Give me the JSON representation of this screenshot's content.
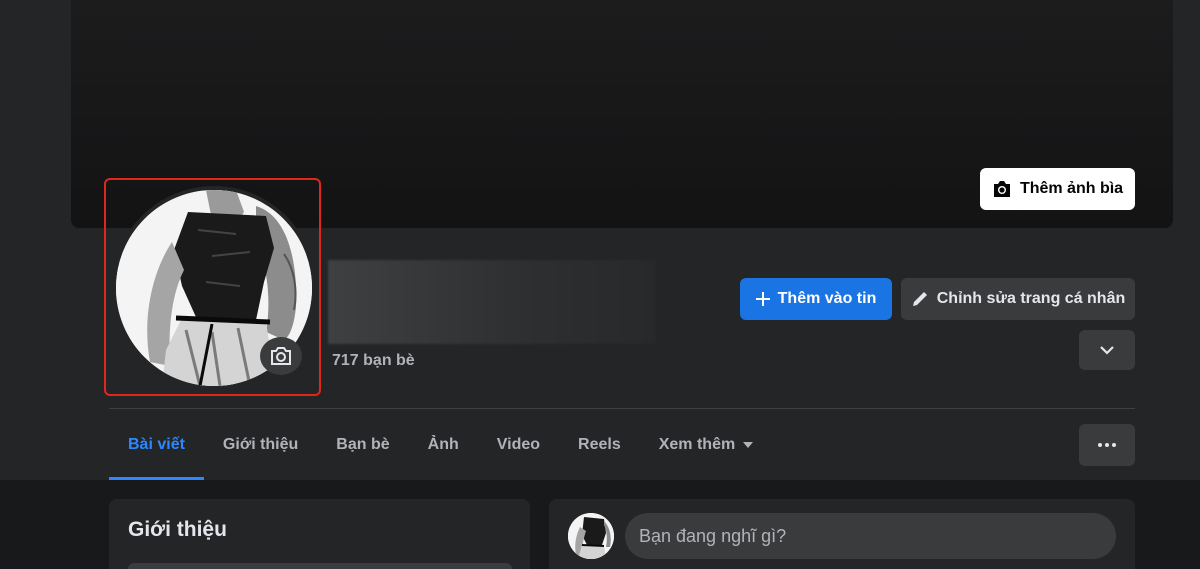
{
  "cover": {
    "add_cover_label": "Thêm ảnh bìa"
  },
  "profile": {
    "friends_count": "717 bạn bè"
  },
  "actions": {
    "add_story_label": "Thêm vào tin",
    "edit_profile_label": "Chỉnh sửa trang cá nhân"
  },
  "tabs": [
    {
      "label": "Bài viết"
    },
    {
      "label": "Giới thiệu"
    },
    {
      "label": "Bạn bè"
    },
    {
      "label": "Ảnh"
    },
    {
      "label": "Video"
    },
    {
      "label": "Reels"
    },
    {
      "label": "Xem thêm"
    }
  ],
  "intro": {
    "title": "Giới thiệu"
  },
  "composer": {
    "placeholder": "Bạn đang nghĩ gì?"
  },
  "colors": {
    "accent": "#1b74e4",
    "background": "#18191a",
    "card": "#242526",
    "highlight": "#e0271b"
  },
  "icons": {
    "add_cover": "camera-icon",
    "avatar_update": "camera-icon",
    "add_story": "plus-icon",
    "edit_profile": "pencil-icon",
    "expand": "chevron-down-icon",
    "tab_more": "triangle-down-icon",
    "more_options": "more-horizontal-icon"
  }
}
